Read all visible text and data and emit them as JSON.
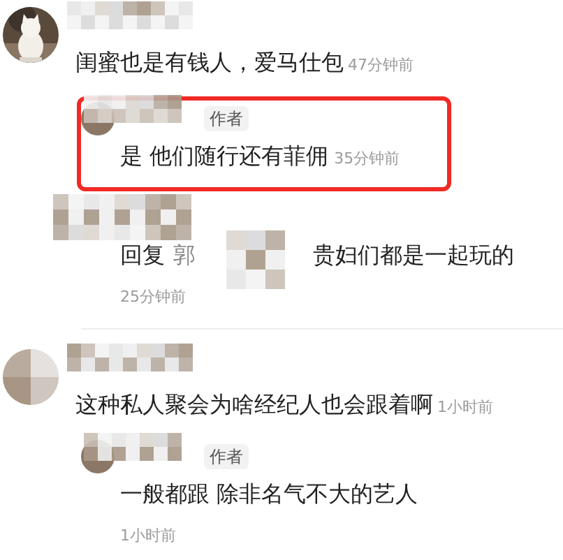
{
  "comments": [
    {
      "text": "闺蜜也是有钱人，爱马仕包",
      "time": "47分钟前",
      "replies": [
        {
          "kind": "author",
          "badge": "作者",
          "text": "是 他们随行还有菲佣",
          "time": "35分钟前",
          "time_inline": true,
          "highlighted": true
        },
        {
          "kind": "reply_to",
          "prefix": "回复",
          "target": "郭",
          "text": "贵妇们都是一起玩的",
          "time": "25分钟前",
          "time_inline": false,
          "highlighted": false
        }
      ]
    },
    {
      "avatar": {
        "kind": "blurred"
      },
      "text": "这种私人聚会为啥经纪人也会跟着啊",
      "time": "1小时前",
      "replies": [
        {
          "kind": "author",
          "badge": "作者",
          "text": "一般都跟 除非名气不大的艺人",
          "time": "1小时前",
          "time_inline": false,
          "highlighted": false
        }
      ]
    }
  ]
}
